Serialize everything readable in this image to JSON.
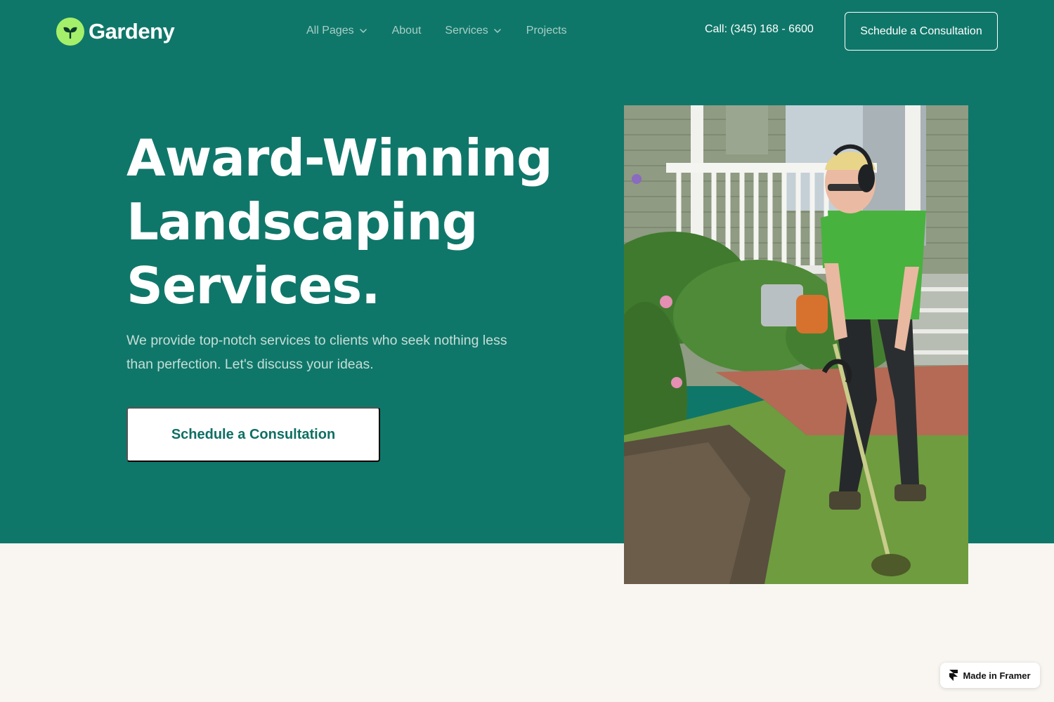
{
  "brand": {
    "name": "Gardeny",
    "logo_icon": "sprout-icon",
    "accent": "#a5f06a",
    "primary": "#0f7769"
  },
  "nav": {
    "items": [
      {
        "label": "All Pages",
        "has_dropdown": true
      },
      {
        "label": "About",
        "has_dropdown": false
      },
      {
        "label": "Services",
        "has_dropdown": true
      },
      {
        "label": "Projects",
        "has_dropdown": false
      }
    ]
  },
  "header": {
    "phone": "Call: (345) 168 - 6600",
    "cta_label": "Schedule a Consultation"
  },
  "hero": {
    "headline": [
      "Award-Winning",
      "Landscaping",
      "Services."
    ],
    "subtext": "We provide top-notch services to clients who seek nothing less than perfection. Let's discuss your ideas.",
    "cta_label": "Schedule a Consultation"
  },
  "badge": {
    "label": "Made in Framer",
    "icon": "framer-icon"
  }
}
